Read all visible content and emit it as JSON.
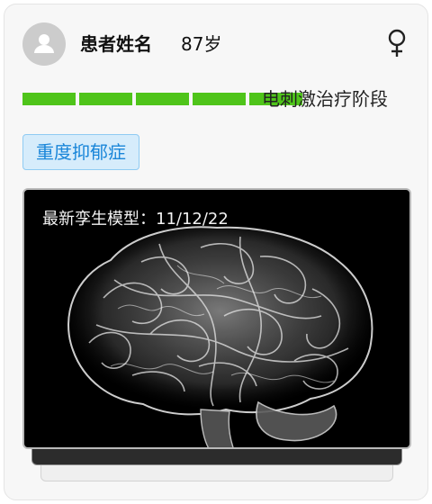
{
  "patient": {
    "name": "患者姓名",
    "age": "87岁",
    "gender_icon": "female-icon"
  },
  "treatment": {
    "stage_label": "电刺激治疗阶段",
    "progress_segments_filled": 5,
    "progress_segments_total": 5,
    "progress_color": "#4fc41a"
  },
  "diagnosis": {
    "tag_label": "重度抑郁症",
    "tag_color": "#1a86d9"
  },
  "model": {
    "caption": "最新孪生模型：11/12/22",
    "image_icon": "brain-scan-image"
  }
}
